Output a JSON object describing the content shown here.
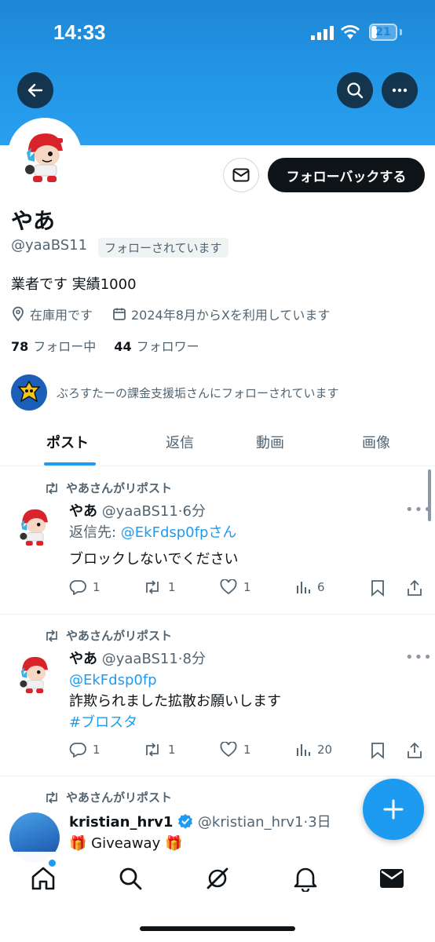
{
  "status_bar": {
    "time": "14:33",
    "battery": "21",
    "battery_level": 0.21
  },
  "profile": {
    "display_name": "やあ",
    "handle": "@yaaBS11",
    "follows_you": "フォローされています",
    "follow_back_label": "フォローバックする",
    "bio": "業者です 実績1000",
    "location": "在庫用です",
    "joined": "2024年8月からXを利用しています",
    "following_count": "78",
    "following_label": "フォロー中",
    "followers_count": "44",
    "followers_label": "フォロワー",
    "followed_by_note": "ぶろすたーの課金支援垢さんにフォローされています"
  },
  "tabs": [
    {
      "label": "ポスト",
      "active": true
    },
    {
      "label": "返信",
      "active": false
    },
    {
      "label": "動画",
      "active": false
    },
    {
      "label": "画像",
      "active": false
    }
  ],
  "posts": [
    {
      "repost_label": "やあさんがリポスト",
      "name": "やあ",
      "meta": "@yaaBS11·6分",
      "reply_prefix": "返信先: ",
      "reply_to": "@EkFdsp0fpさん",
      "text": "ブロックしないでください",
      "replies": "1",
      "reposts": "1",
      "likes": "1",
      "views": "6"
    },
    {
      "repost_label": "やあさんがリポスト",
      "name": "やあ",
      "meta": "@yaaBS11·8分",
      "mention": "@EkFdsp0fp",
      "text": "詐欺られました拡散お願いします",
      "hashtag": "#ブロスタ",
      "replies": "1",
      "reposts": "1",
      "likes": "1",
      "views": "20"
    },
    {
      "repost_label": "やあさんがリポスト",
      "name": "kristian_hrv1",
      "meta": "@kristian_hrv1·3日",
      "text": "🎁 Giveaway 🎁"
    }
  ],
  "colors": {
    "accent": "#1d9bf0",
    "banner": "#2396e6",
    "text": "#0f1419",
    "muted": "#536471"
  }
}
